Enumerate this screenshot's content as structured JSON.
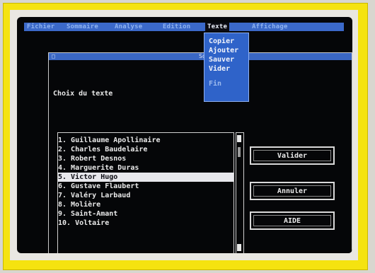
{
  "menubar": {
    "items": [
      {
        "label": "Fichier"
      },
      {
        "label": "Sommaire"
      },
      {
        "label": "Analyse"
      },
      {
        "label": "Edition"
      },
      {
        "label": "Texte"
      },
      {
        "label": "Affichage"
      }
    ],
    "active_index": 4
  },
  "dropdown": {
    "items": [
      {
        "label": "Copier",
        "enabled": true
      },
      {
        "label": "Ajouter",
        "enabled": true
      },
      {
        "label": "Sauver",
        "enabled": true
      },
      {
        "label": "Vider",
        "enabled": true
      },
      {
        "label": "Fin",
        "enabled": false
      }
    ]
  },
  "dialog": {
    "title": "Sommaire",
    "close_glyph": "□",
    "choice_label": "Choix du texte",
    "list": {
      "items": [
        "1. Guillaume Apollinaire",
        "2. Charles Baudelaire",
        "3. Robert Desnos",
        "4. Marguerite Duras",
        "5. Victor Hugo",
        "6. Gustave Flaubert",
        "7. Valéry Larbaud",
        "8. Molière",
        "9. Saint-Amant",
        "10. Voltaire"
      ],
      "selected_index": 4
    },
    "buttons": {
      "validate": "Valider",
      "cancel": "Annuler",
      "help": "AIDE"
    }
  },
  "colors": {
    "frame": "#f5e310",
    "menubar": "#3b69c9",
    "screen": "#050608",
    "selection": "#e8e8ec"
  }
}
